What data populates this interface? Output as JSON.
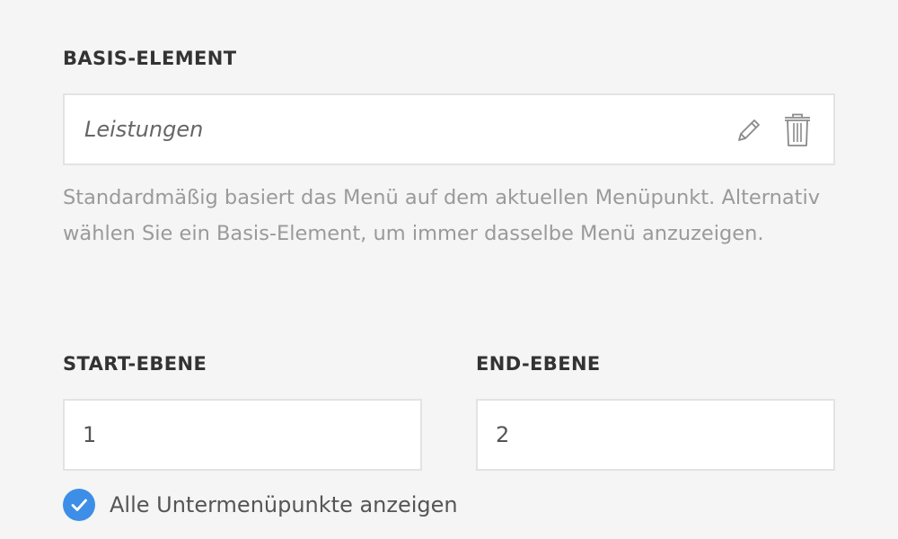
{
  "base_element": {
    "label": "BASIS-ELEMENT",
    "value": "Leistungen",
    "edit_icon": "pencil-icon",
    "delete_icon": "trash-icon",
    "help_text": "Standardmäßig basiert das Menü auf dem aktuellen Menüpunkt. Alternativ wählen Sie ein Basis-Element, um immer dasselbe Menü anzuzeigen."
  },
  "start_level": {
    "label": "START-EBENE",
    "value": "1"
  },
  "end_level": {
    "label": "END-EBENE",
    "value": "2"
  },
  "show_all_submenu": {
    "label": "Alle Untermenüpunkte anzeigen",
    "checked": true,
    "icon": "checkmark-icon"
  },
  "colors": {
    "background": "#f5f5f5",
    "accent": "#3d8ee6",
    "heading": "#333333",
    "help_text": "#9a9a9a"
  }
}
